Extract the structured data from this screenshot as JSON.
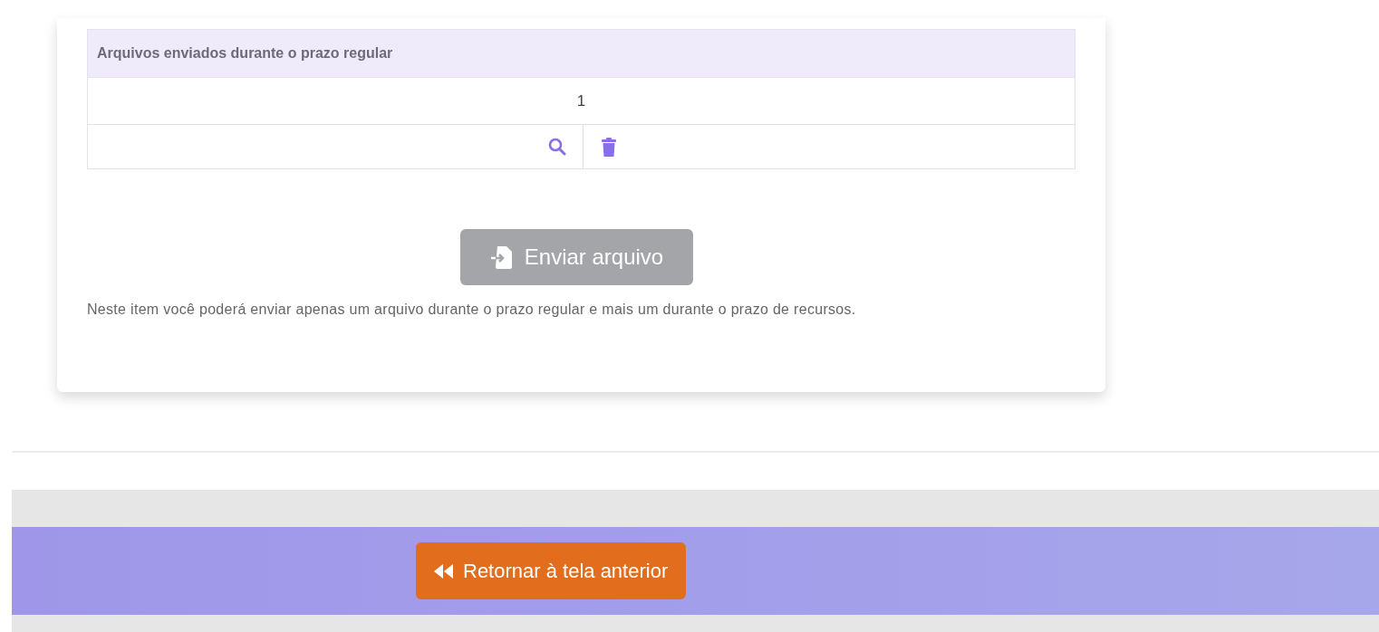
{
  "files_table": {
    "header": "Arquivos enviados durante o prazo regular",
    "rows": [
      {
        "kind": "number",
        "text": "1"
      },
      {
        "kind": "actions"
      }
    ]
  },
  "upload_button": {
    "label": "Enviar arquivo",
    "disabled": true
  },
  "note": "Neste item você poderá enviar apenas um arquivo durante o prazo regular e mais um durante o prazo de recursos.",
  "footer": {
    "back_button": {
      "label": "Retornar à tela anterior"
    }
  }
}
